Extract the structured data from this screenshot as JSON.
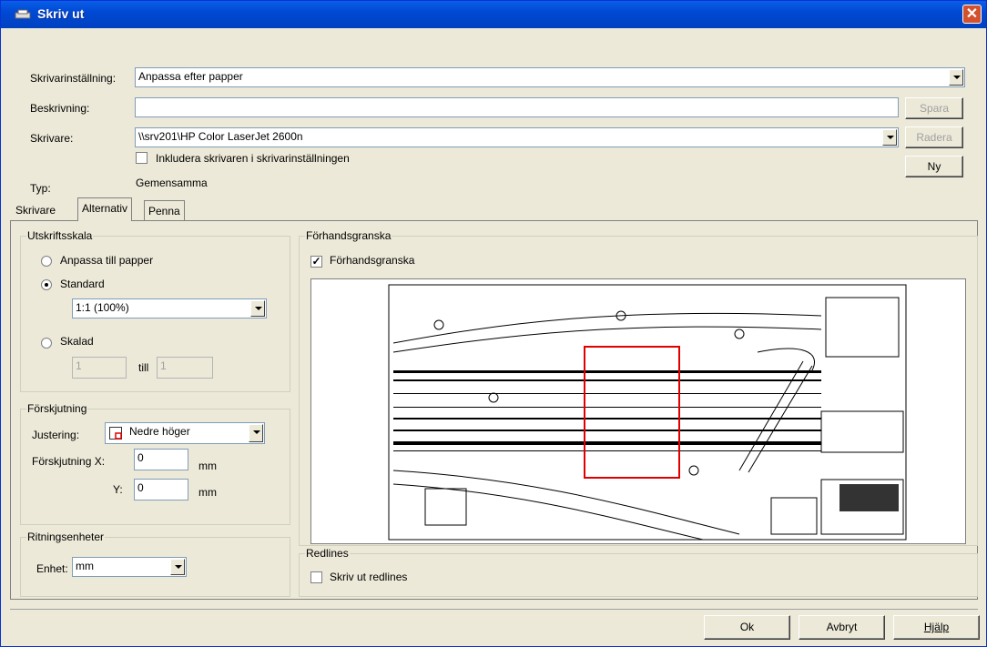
{
  "window": {
    "title": "Skriv ut",
    "close_icon": "close-icon"
  },
  "top": {
    "printer_setting_label": "Skrivarinställning:",
    "printer_setting_value": "Anpassa efter papper",
    "description_label": "Beskrivning:",
    "description_value": "",
    "printer_label": "Skrivare:",
    "printer_value": "\\\\srv201\\HP Color LaserJet 2600n",
    "include_printer_label": "Inkludera skrivaren i skrivarinställningen",
    "type_label": "Typ:",
    "type_value": "Gemensamma",
    "save_label": "Spara",
    "delete_label": "Radera",
    "new_label": "Ny"
  },
  "tabs": [
    {
      "label": "Skrivare",
      "active": false
    },
    {
      "label": "Alternativ",
      "active": true
    },
    {
      "label": "Penna",
      "active": false
    }
  ],
  "scale": {
    "title": "Utskriftsskala",
    "fit_label": "Anpassa till papper",
    "standard_label": "Standard",
    "standard_value": "1:1  (100%)",
    "scaled_label": "Skalad",
    "scaled_from": "1",
    "to_label": "till",
    "scaled_to": "1",
    "selected": "Standard"
  },
  "offset": {
    "title": "Förskjutning",
    "align_label": "Justering:",
    "align_value": "Nedre höger",
    "x_label": "Förskjutning  X:",
    "x_value": "0",
    "y_label": "Y:",
    "y_value": "0",
    "unit_x": "mm",
    "unit_y": "mm"
  },
  "units": {
    "title": "Ritningsenheter",
    "unit_label": "Enhet:",
    "unit_value": "mm"
  },
  "preview": {
    "title": "Förhandsgranska",
    "checkbox_label": "Förhandsgranska",
    "checked": true
  },
  "redlines": {
    "title": "Redlines",
    "checkbox_label": "Skriv ut redlines",
    "checked": false
  },
  "buttons": {
    "ok": "Ok",
    "cancel": "Avbryt",
    "help": "Hjälp"
  },
  "colors": {
    "titlebar": "#0054e3",
    "frame_red": "#e00000"
  }
}
